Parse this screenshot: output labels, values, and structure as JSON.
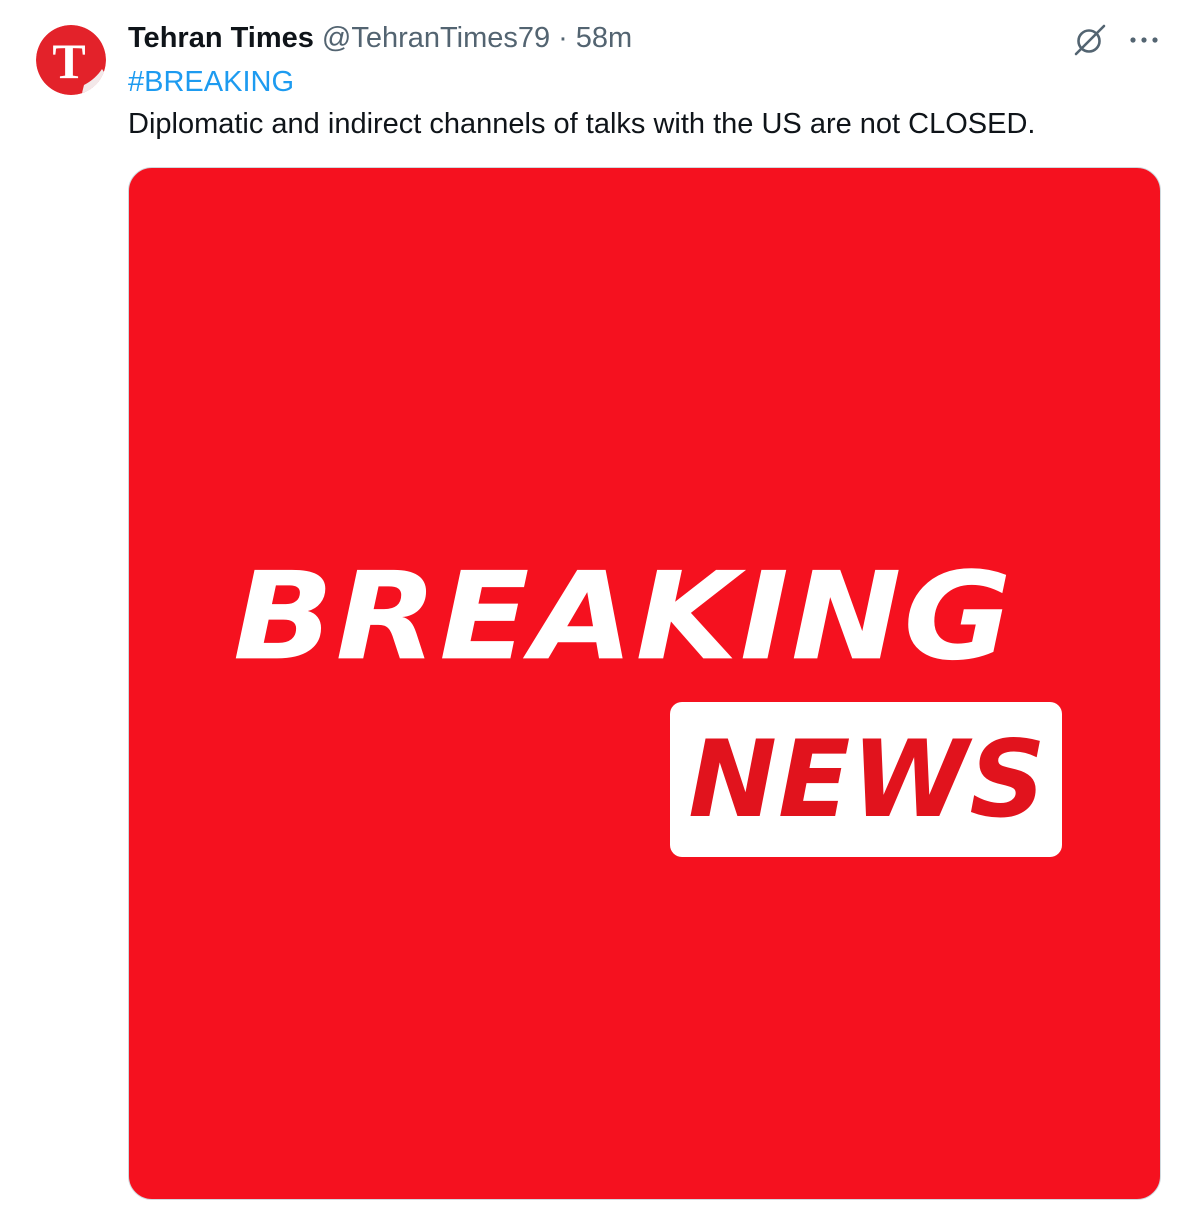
{
  "tweet": {
    "display_name": "Tehran Times",
    "handle": "@TehranTimes79",
    "separator": "·",
    "time_ago": "58m",
    "hashtag": "#BREAKING",
    "text": "Diplomatic and indirect channels of talks with the US are not CLOSED.",
    "avatar_letter": "T"
  },
  "media": {
    "headline_top": "BREAKING",
    "headline_bottom": "NEWS",
    "background_color": "#f5111f",
    "accent_color": "#e1131d"
  },
  "icons": {
    "grok": "grok-icon",
    "more": "more-icon"
  },
  "colors": {
    "link": "#1d9bf0",
    "secondary_text": "#536471",
    "primary_text": "#0f1419"
  }
}
